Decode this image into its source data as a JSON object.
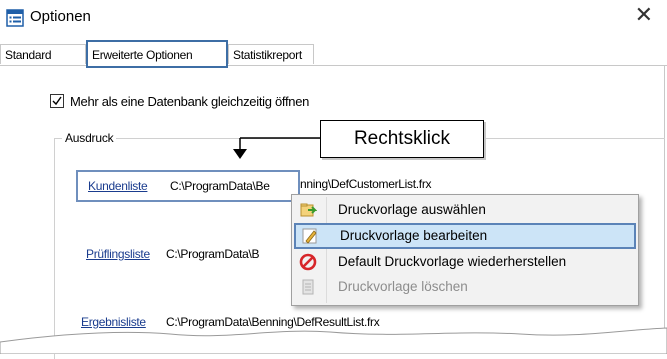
{
  "window": {
    "title": "Optionen",
    "close_glyph": "✕",
    "icon": "options-window-icon"
  },
  "tabs": [
    {
      "label": "Standard",
      "active": false
    },
    {
      "label": "Erweiterte Optionen",
      "active": true
    },
    {
      "label": "Statistikreport",
      "active": false
    }
  ],
  "options": {
    "multi_db_checkbox": {
      "label": "Mehr als eine Datenbank gleichzeitig öffnen",
      "checked": true
    }
  },
  "ausdruck": {
    "legend": "Ausdruck",
    "rows": [
      {
        "link": "Kundenliste",
        "path_visible": "C:\\ProgramData\\Be",
        "path_tail": "nning\\DefCustomerList.frx"
      },
      {
        "link": "Prüflingsliste",
        "path_visible": "C:\\ProgramData\\B"
      },
      {
        "link": "Ergebnisliste",
        "path_visible": "C:\\ProgramData\\Benning\\DefResultList.frx"
      }
    ]
  },
  "callout": {
    "text": "Rechtsklick"
  },
  "context_menu": {
    "items": [
      {
        "label": "Druckvorlage auswählen",
        "icon": "select-template-icon",
        "enabled": true,
        "highlighted": false
      },
      {
        "label": "Druckvorlage bearbeiten",
        "icon": "edit-template-icon",
        "enabled": true,
        "highlighted": true
      },
      {
        "label": "Default Druckvorlage wiederherstellen",
        "icon": "restore-default-icon",
        "enabled": true,
        "highlighted": false
      },
      {
        "label": "Druckvorlage löschen",
        "icon": "delete-template-icon",
        "enabled": false,
        "highlighted": false
      }
    ]
  },
  "colors": {
    "tab_highlight": "#3d6ea5",
    "link": "#1a3c8e",
    "menu_highlight_bg": "#cce4f7",
    "menu_highlight_border": "#5b83b7",
    "disabled_text": "#8d8d8d"
  }
}
